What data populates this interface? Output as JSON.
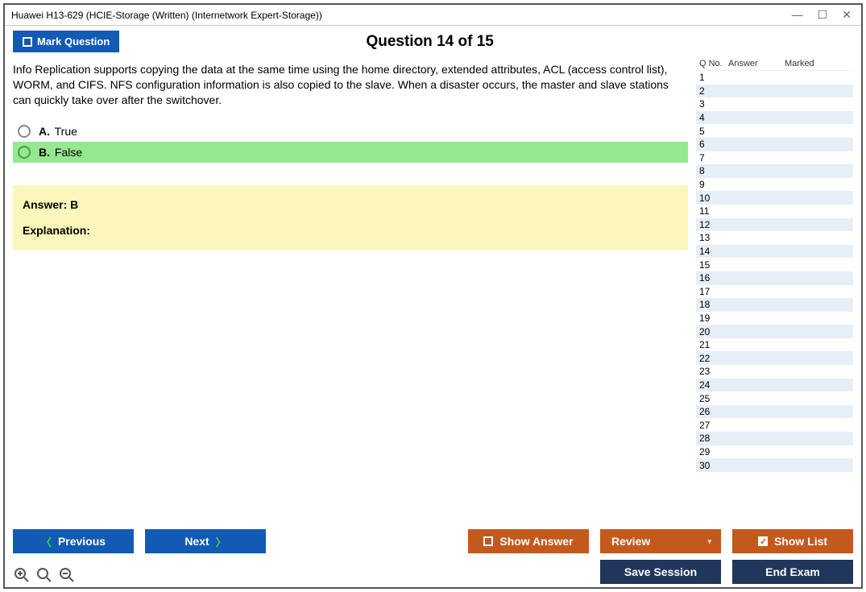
{
  "window": {
    "title": "Huawei H13-629 (HCIE-Storage (Written) (Internetwork Expert-Storage))"
  },
  "top": {
    "mark_label": "Mark Question",
    "heading": "Question 14 of 15"
  },
  "question": {
    "text": "Info Replication supports copying the data at the same time using the home directory, extended attributes, ACL (access control list), WORM, and CIFS. NFS configuration information is also copied to the slave. When a disaster occurs, the master and slave stations can quickly take over after the switchover."
  },
  "options": [
    {
      "letter": "A.",
      "text": "True",
      "correct": false
    },
    {
      "letter": "B.",
      "text": "False",
      "correct": true
    }
  ],
  "answer_box": {
    "answer_label": "Answer: B",
    "explanation_label": "Explanation:"
  },
  "side": {
    "col_qno": "Q No.",
    "col_answer": "Answer",
    "col_marked": "Marked",
    "rows": [
      1,
      2,
      3,
      4,
      5,
      6,
      7,
      8,
      9,
      10,
      11,
      12,
      13,
      14,
      15,
      16,
      17,
      18,
      19,
      20,
      21,
      22,
      23,
      24,
      25,
      26,
      27,
      28,
      29,
      30
    ]
  },
  "buttons": {
    "previous": "Previous",
    "next": "Next",
    "show_answer": "Show Answer",
    "review": "Review",
    "show_list": "Show List",
    "save_session": "Save Session",
    "end_exam": "End Exam"
  }
}
